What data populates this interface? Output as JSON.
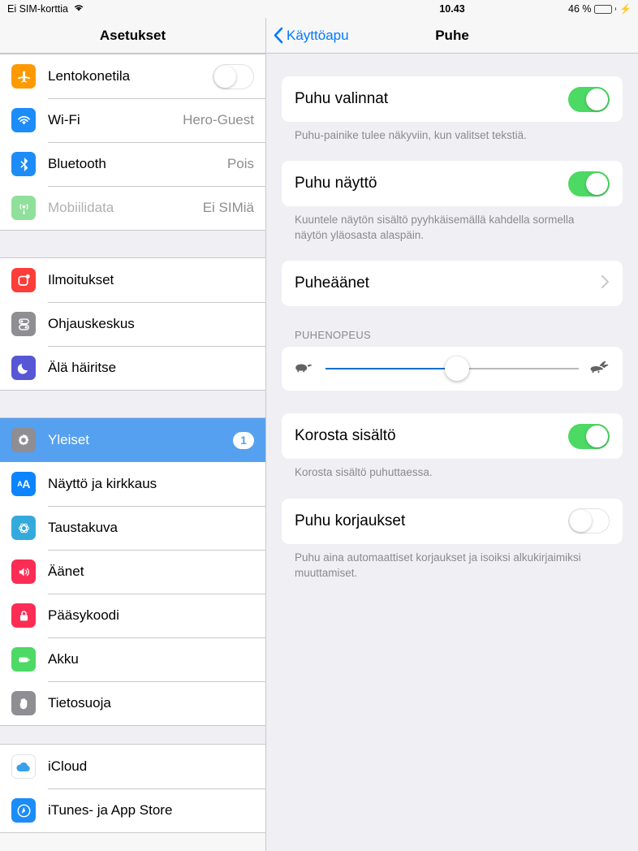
{
  "statusbar": {
    "carrier": "Ei SIM-korttia",
    "wifi_icon": "wifi-icon",
    "time": "10.43",
    "battery_text": "46 %",
    "battery_percent": 46,
    "charging_icon": "lightning-bolt-icon"
  },
  "sidebar": {
    "title": "Asetukset",
    "groups": [
      {
        "items": [
          {
            "label": "Lentokonetila",
            "icon": "airplane-icon",
            "color": "#f90",
            "control": "toggle",
            "toggle_on": false
          },
          {
            "label": "Wi-Fi",
            "icon": "wifi-icon",
            "color": "#1c8cf8",
            "value": "Hero-Guest"
          },
          {
            "label": "Bluetooth",
            "icon": "bluetooth-icon",
            "color": "#1c8cf8",
            "value": "Pois"
          },
          {
            "label": "Mobiilidata",
            "icon": "cellular-antenna-icon",
            "color": "#8fe09a",
            "value": "Ei SIMiä",
            "dimmed": true
          }
        ]
      },
      {
        "items": [
          {
            "label": "Ilmoitukset",
            "icon": "notifications-icon",
            "color": "#fc3d39"
          },
          {
            "label": "Ohjauskeskus",
            "icon": "control-center-icon",
            "color": "#8e8e93"
          },
          {
            "label": "Älä häiritse",
            "icon": "moon-icon",
            "color": "#5757d6"
          }
        ]
      },
      {
        "items": [
          {
            "label": "Yleiset",
            "icon": "gear-icon",
            "color": "#8e8e93",
            "selected": true,
            "badge": "1"
          },
          {
            "label": "Näyttö ja kirkkaus",
            "icon": "display-brightness-icon",
            "color": "#0b84ff"
          },
          {
            "label": "Taustakuva",
            "icon": "wallpaper-flower-icon",
            "color": "#34aadc"
          },
          {
            "label": "Äänet",
            "icon": "speaker-icon",
            "color": "#fc2d55"
          },
          {
            "label": "Pääsykoodi",
            "icon": "lock-icon",
            "color": "#fc2d55"
          },
          {
            "label": "Akku",
            "icon": "battery-icon",
            "color": "#4cd964"
          },
          {
            "label": "Tietosuoja",
            "icon": "hand-privacy-icon",
            "color": "#8e8e93"
          }
        ]
      },
      {
        "items": [
          {
            "label": "iCloud",
            "icon": "icloud-icon",
            "color": "#ffffff"
          },
          {
            "label": "iTunes- ja App Store",
            "icon": "app-store-icon",
            "color": "#1c8cf8"
          }
        ]
      }
    ]
  },
  "detail": {
    "back_label": "Käyttöapu",
    "back_icon": "chevron-left-icon",
    "title": "Puhe",
    "sections": [
      {
        "row_label": "Puhu valinnat",
        "control": "toggle",
        "toggle_on": true,
        "footnote": "Puhu-painike tulee näkyviin, kun valitset tekstiä."
      },
      {
        "row_label": "Puhu näyttö",
        "control": "toggle",
        "toggle_on": true,
        "footnote": "Kuuntele näytön sisältö pyyhkäisemällä kahdella sormella näytön yläosasta alaspäin."
      },
      {
        "row_label": "Puheäänet",
        "control": "disclosure",
        "disclosure_icon": "chevron-right-icon"
      }
    ],
    "speed_section": {
      "header": "PUHENOPEUS",
      "slow_icon": "tortoise-icon",
      "fast_icon": "hare-icon",
      "value_percent": 52
    },
    "sections_bottom": [
      {
        "row_label": "Korosta sisältö",
        "control": "toggle",
        "toggle_on": true,
        "footnote": "Korosta sisältö puhuttaessa."
      },
      {
        "row_label": "Puhu korjaukset",
        "control": "toggle",
        "toggle_on": false,
        "footnote": "Puhu aina automaattiset korjaukset ja isoiksi alkukirjaimiksi muuttamiset."
      }
    ]
  }
}
